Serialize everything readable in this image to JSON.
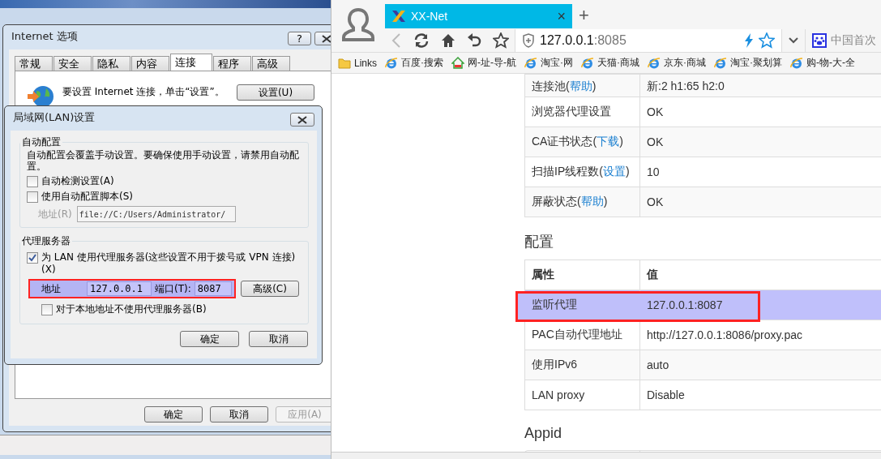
{
  "internet_options": {
    "title": "Internet 选项",
    "help_button": "?",
    "tabs": [
      {
        "label": "常规",
        "selected": false
      },
      {
        "label": "安全",
        "selected": false
      },
      {
        "label": "隐私",
        "selected": false
      },
      {
        "label": "内容",
        "selected": false
      },
      {
        "label": "连接",
        "selected": true
      },
      {
        "label": "程序",
        "selected": false
      },
      {
        "label": "高级",
        "selected": false
      }
    ],
    "intro_text": "要设置 Internet 连接，单击“设置”。",
    "settings_button": "设置(U)",
    "buttons": [
      {
        "label": "确定",
        "disabled": false
      },
      {
        "label": "取消",
        "disabled": false
      },
      {
        "label": "应用(A)",
        "disabled": true
      }
    ]
  },
  "lan_dialog": {
    "title": "局域网(LAN)设置",
    "auto_config": {
      "legend": "自动配置",
      "description": "自动配置会覆盖手动设置。要确保使用手动设置，请禁用自动配置。",
      "options": [
        {
          "label": "自动检测设置(A)",
          "checked": false
        },
        {
          "label": "使用自动配置脚本(S)",
          "checked": false
        }
      ],
      "address": {
        "label": "地址(R)",
        "value": "file://C:/Users/Administrator/",
        "disabled": true
      }
    },
    "proxy": {
      "legend": "代理服务器",
      "use_proxy": {
        "label": "为 LAN 使用代理服务器(这些设置不用于拨号或 VPN 连接)(X)",
        "checked": true
      },
      "address_label": "地址",
      "address": "127.0.0.1",
      "port_label": "端口(T):",
      "port": "8087",
      "highlighted": true,
      "advanced_button": "高级(C)",
      "bypass_local": {
        "label": "对于本地地址不使用代理服务器(B)",
        "checked": false
      }
    },
    "buttons": [
      "确定",
      "取消"
    ]
  },
  "browser": {
    "tab": {
      "title": "XX-Net",
      "close": "×",
      "selected": true
    },
    "new_tab": "+",
    "url_host": "127.0.0.1",
    "url_port": ":8085",
    "search_text": "中国首次",
    "bookmarks": [
      {
        "label": "Links",
        "kind": "folder"
      },
      {
        "label": "百度·搜索",
        "kind": "ie"
      },
      {
        "label": "网-址-导-航",
        "kind": "house"
      },
      {
        "label": "淘宝·网",
        "kind": "ie"
      },
      {
        "label": "天猫·商城",
        "kind": "ie"
      },
      {
        "label": "京东·商城",
        "kind": "ie"
      },
      {
        "label": "淘宝·聚划算",
        "kind": "ie"
      },
      {
        "label": "购-物-大-全",
        "kind": "ie"
      }
    ],
    "status_rows": [
      {
        "label": "连接池(",
        "link": "帮助",
        "label_end": ")",
        "value": "新:2 h1:65 h2:0"
      },
      {
        "label": "浏览器代理设置",
        "value": "OK"
      },
      {
        "label": "CA证书状态(",
        "link": "下载",
        "label_end": ")",
        "value": "OK"
      },
      {
        "label": "扫描IP线程数(",
        "link": "设置",
        "label_end": ")",
        "value": "10"
      },
      {
        "label": "屏蔽状态(",
        "link": "帮助",
        "label_end": ")",
        "value": "OK"
      }
    ],
    "config": {
      "heading": "配置",
      "columns": [
        "属性",
        "值"
      ],
      "rows": [
        {
          "label": "监听代理",
          "value": "127.0.0.1:8087",
          "highlighted": true
        },
        {
          "label": "PAC自动代理地址",
          "value": "http://127.0.0.1:8086/proxy.pac",
          "highlighted": false
        },
        {
          "label": "使用IPv6",
          "value": "auto",
          "highlighted": false
        },
        {
          "label": "LAN proxy",
          "value": "Disable",
          "highlighted": false
        }
      ]
    },
    "appid": {
      "heading": "Appid"
    }
  }
}
